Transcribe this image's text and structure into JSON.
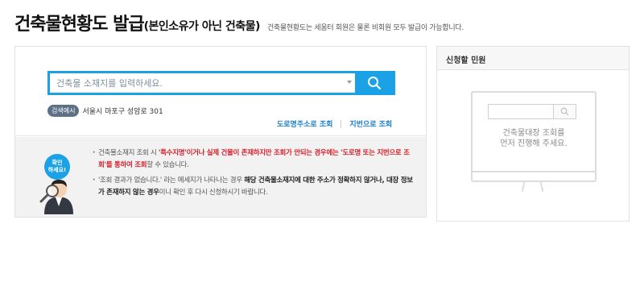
{
  "header": {
    "title_main": "건축물현황도 발급",
    "title_sub": "(본인소유가 아닌 건축물)",
    "description": "건축물현황도는 세움터 회원은 물론 비회원 모두 발급이 가능합니다."
  },
  "search": {
    "placeholder": "건축물 소재지를 입력하세요.",
    "button_icon": "search-icon",
    "example_badge": "검색예시",
    "example_text": "서울시 마포구 성암로 301",
    "links": [
      "도로명주소로 조회",
      "지번으로 조회"
    ]
  },
  "notice": {
    "badge_line1": "확인",
    "badge_line2": "하세요!",
    "item1": {
      "prefix": "건축물소재지 조회 시 ",
      "highlight": "'특수지명'이거나 실제 건물이 존재하지만 조회가 안되는 경우에는 '도로명 또는 지번으로 조회'를 통하여 조회",
      "suffix": "할 수 있습니다."
    },
    "item2": {
      "prefix": "'조회 결과가 없습니다.' 라는 메세지가 나타나는 경우 ",
      "highlight1": "해당 건축물소재지에 대한 주소가 정확하지 않거나, 대장 정보가 존재하지 않는 경우",
      "suffix": "이니 확인 후 다시 신청하시기 바랍니다."
    }
  },
  "side": {
    "header": "신청할 민원",
    "message_line1": "건축물대장 조회를",
    "message_line2": "먼저 진행해 주세요."
  },
  "colors": {
    "accent": "#1aa1e6",
    "link": "#1a7fcf",
    "warning": "#d6202b",
    "badge": "#5d7086"
  }
}
